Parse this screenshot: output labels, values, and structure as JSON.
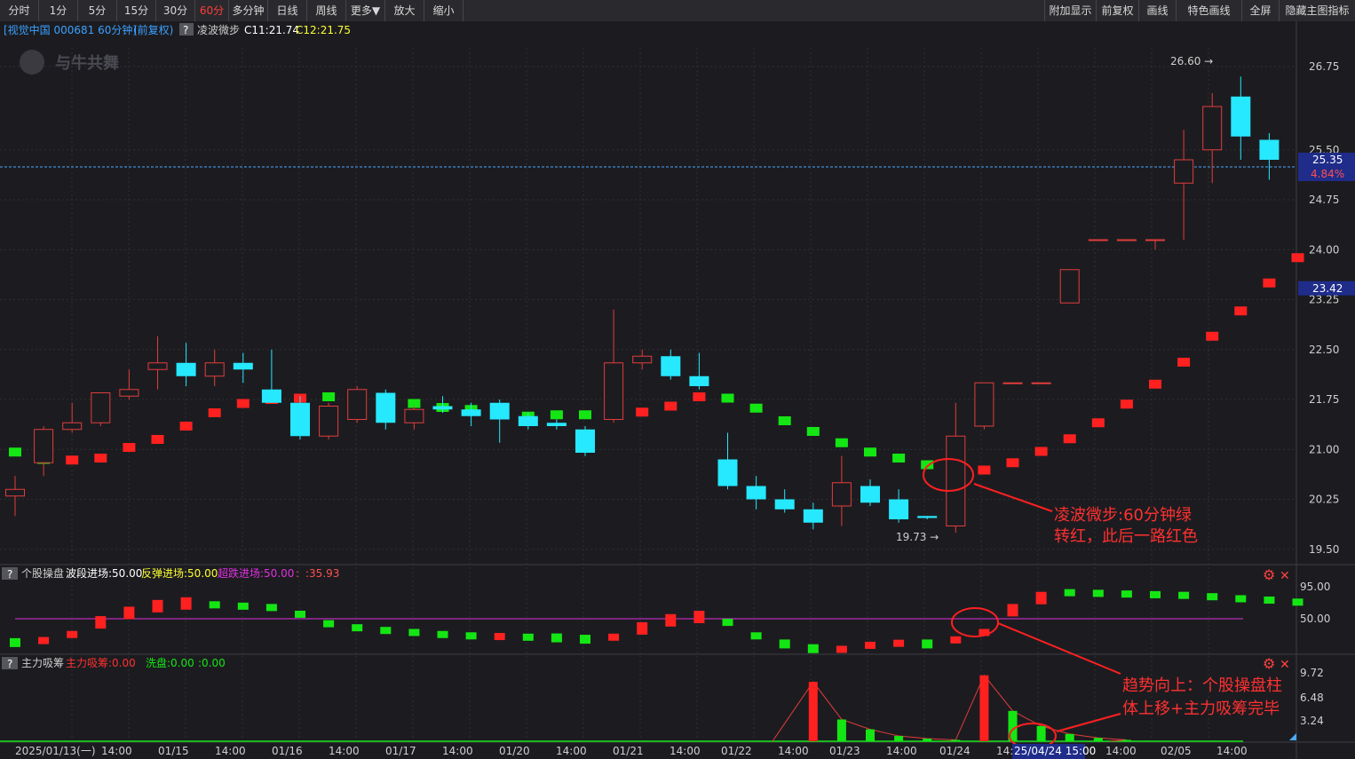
{
  "toolbar": {
    "left": [
      "分时",
      "1分",
      "5分",
      "15分",
      "30分",
      "60分",
      "多分钟",
      "日线",
      "周线",
      "更多▼",
      "放大",
      "缩小"
    ],
    "active": "60分",
    "right": [
      "附加显示",
      "前复权",
      "画线",
      "特色画线",
      "全屏",
      "隐藏主图指标"
    ]
  },
  "header": {
    "title": "[视觉中国 000681 60分钟]",
    "adjust": "(前复权)",
    "help": "?",
    "indicator": "凌波微步",
    "c1": "C11:21.74",
    "c2": "C12:21.75"
  },
  "watermark": "与牛共舞",
  "price_axis": {
    "ticks": [
      "26.75",
      "25.50",
      "24.75",
      "24.00",
      "23.25",
      "22.50",
      "21.75",
      "21.00",
      "20.25",
      "19.50"
    ],
    "current_price": "25.35",
    "current_pct": "4.84%",
    "level_price": "23.42"
  },
  "max_label": "26.60",
  "min_label": "19.73",
  "annotation1": {
    "line1": "凌波微步:60分钟绿",
    "line2": "转红，此后一路红色"
  },
  "annotation2": {
    "line1": "趋势向上：个股操盘柱",
    "line2": "体上移+主力吸筹完毕"
  },
  "panel2": {
    "help": "?",
    "name": "个股操盘",
    "s1": "波段进场:50.00",
    "s2": "反弹进场:50.00",
    "s3": "超跌进场:50.00",
    "s4": ":",
    "s5": ":35.93",
    "axis": [
      "95.00",
      "50.00"
    ]
  },
  "panel3": {
    "help": "?",
    "name": "主力吸筹",
    "s1": "主力吸筹:0.00",
    "s2": "洗盘:0.00",
    "s3": ":0.00",
    "axis": [
      "9.72",
      "6.48",
      "3.24"
    ]
  },
  "time_axis": [
    "2025/01/13(一)",
    "14:00",
    "01/15",
    "14:00",
    "01/16",
    "14:00",
    "01/17",
    "14:00",
    "01/20",
    "14:00",
    "01/21",
    "14:00",
    "01/22",
    "14:00",
    "01/23",
    "14:00",
    "01/24",
    "14:",
    "14:00",
    "02/05",
    "14:00"
  ],
  "crosshair_time": "25/04/24 15:00",
  "colors": {
    "up": "#ff2020",
    "down": "#26e8ff",
    "green": "#14e614",
    "magenta": "#e030e0",
    "bg": "#1c1c20"
  },
  "chart_data": {
    "type": "candlestick",
    "candles": [
      [
        20.3,
        20.4,
        20.6,
        20.0
      ],
      [
        20.8,
        21.3,
        21.35,
        20.6
      ],
      [
        21.3,
        21.4,
        21.7,
        21.25
      ],
      [
        21.4,
        21.85,
        21.85,
        21.35
      ],
      [
        21.8,
        21.9,
        22.2,
        21.75
      ],
      [
        22.2,
        22.3,
        22.7,
        21.9
      ],
      [
        22.3,
        22.1,
        22.6,
        21.95
      ],
      [
        22.1,
        22.3,
        22.5,
        21.95
      ],
      [
        22.3,
        22.2,
        22.45,
        22.0
      ],
      [
        21.9,
        21.7,
        22.5,
        21.7
      ],
      [
        21.7,
        21.2,
        21.8,
        21.15
      ],
      [
        21.2,
        21.65,
        21.7,
        21.15
      ],
      [
        21.45,
        21.9,
        21.95,
        21.4
      ],
      [
        21.85,
        21.4,
        21.9,
        21.3
      ],
      [
        21.4,
        21.6,
        21.65,
        21.3
      ],
      [
        21.65,
        21.6,
        21.8,
        21.55
      ],
      [
        21.6,
        21.5,
        21.7,
        21.35
      ],
      [
        21.7,
        21.45,
        21.75,
        21.1
      ],
      [
        21.5,
        21.35,
        21.55,
        21.3
      ],
      [
        21.4,
        21.35,
        21.45,
        21.3
      ],
      [
        21.3,
        20.95,
        21.35,
        20.9
      ],
      [
        21.45,
        22.3,
        23.1,
        21.4
      ],
      [
        22.3,
        22.4,
        22.5,
        22.2
      ],
      [
        22.4,
        22.1,
        22.5,
        22.05
      ],
      [
        22.1,
        21.95,
        22.45,
        21.9
      ],
      [
        20.85,
        20.45,
        21.25,
        20.4
      ],
      [
        20.45,
        20.25,
        20.6,
        20.1
      ],
      [
        20.25,
        20.1,
        20.4,
        20.05
      ],
      [
        20.1,
        19.9,
        20.2,
        19.8
      ],
      [
        20.15,
        20.5,
        20.9,
        19.85
      ],
      [
        20.45,
        20.2,
        20.55,
        20.15
      ],
      [
        20.25,
        19.95,
        20.4,
        19.9
      ],
      [
        20.0,
        19.97,
        20.0,
        19.95
      ],
      [
        19.85,
        21.2,
        21.7,
        19.75
      ],
      [
        21.35,
        22.0,
        22.0,
        21.3
      ],
      [
        22.0,
        22.0,
        22.0,
        22.0
      ],
      [
        22.0,
        22.0,
        22.0,
        22.0
      ],
      [
        23.2,
        23.7,
        23.7,
        23.25
      ],
      [
        24.15,
        24.15,
        24.15,
        24.15
      ],
      [
        24.15,
        24.15,
        24.15,
        24.15
      ],
      [
        24.15,
        24.15,
        24.15,
        24.0
      ],
      [
        25.0,
        25.35,
        25.8,
        24.15
      ],
      [
        25.5,
        26.15,
        26.35,
        25.0
      ],
      [
        26.3,
        25.7,
        26.6,
        25.35
      ],
      [
        25.65,
        25.35,
        25.75,
        25.05
      ]
    ],
    "signal_blocks": [
      [
        0,
        "green",
        20.96
      ],
      [
        1,
        "green",
        20.85
      ],
      [
        2,
        "red",
        20.84
      ],
      [
        3,
        "red",
        20.87
      ],
      [
        4,
        "red",
        21.03
      ],
      [
        5,
        "red",
        21.15
      ],
      [
        6,
        "red",
        21.35
      ],
      [
        7,
        "red",
        21.55
      ],
      [
        8,
        "red",
        21.69
      ],
      [
        9,
        "red",
        21.75
      ],
      [
        10,
        "red",
        21.77
      ],
      [
        11,
        "green",
        21.79
      ],
      [
        12,
        "green",
        21.76
      ],
      [
        13,
        "green",
        21.71
      ],
      [
        14,
        "green",
        21.69
      ],
      [
        15,
        "green",
        21.63
      ],
      [
        16,
        "green",
        21.6
      ],
      [
        17,
        "green",
        21.58
      ],
      [
        18,
        "green",
        21.5
      ],
      [
        19,
        "green",
        21.52
      ],
      [
        20,
        "green",
        21.52
      ],
      [
        21,
        "red",
        21.53
      ],
      [
        22,
        "red",
        21.56
      ],
      [
        23,
        "red",
        21.65
      ],
      [
        24,
        "red",
        21.79
      ],
      [
        25,
        "green",
        21.77
      ],
      [
        26,
        "green",
        21.62
      ],
      [
        27,
        "green",
        21.43
      ],
      [
        28,
        "green",
        21.27
      ],
      [
        29,
        "green",
        21.1
      ],
      [
        30,
        "green",
        20.96
      ],
      [
        31,
        "green",
        20.87
      ],
      [
        32,
        "green",
        20.77
      ],
      [
        33,
        "green",
        20.68
      ],
      [
        34,
        "red",
        20.69
      ],
      [
        35,
        "red",
        20.8
      ],
      [
        36,
        "red",
        20.97
      ],
      [
        37,
        "red",
        21.16
      ],
      [
        38,
        "red",
        21.4
      ],
      [
        39,
        "red",
        21.68
      ],
      [
        40,
        "red",
        21.98
      ],
      [
        41,
        "red",
        22.31
      ],
      [
        42,
        "red",
        22.7
      ],
      [
        43,
        "red",
        23.08
      ],
      [
        44,
        "red",
        23.5
      ],
      [
        45,
        "red",
        23.88
      ]
    ],
    "panel2_blocks": [
      [
        0,
        "green",
        12
      ],
      [
        1,
        "red",
        15
      ],
      [
        2,
        "red",
        24
      ],
      [
        3,
        "red",
        42
      ],
      [
        4,
        "red",
        56
      ],
      [
        5,
        "red",
        66
      ],
      [
        6,
        "red",
        70
      ],
      [
        7,
        "green",
        68
      ],
      [
        8,
        "green",
        66
      ],
      [
        9,
        "green",
        64
      ],
      [
        10,
        "green",
        54
      ],
      [
        11,
        "green",
        40
      ],
      [
        12,
        "green",
        34
      ],
      [
        13,
        "green",
        30
      ],
      [
        14,
        "green",
        27
      ],
      [
        15,
        "green",
        24
      ],
      [
        16,
        "green",
        22
      ],
      [
        17,
        "red",
        21
      ],
      [
        18,
        "green",
        20
      ],
      [
        19,
        "green",
        19
      ],
      [
        20,
        "green",
        17
      ],
      [
        21,
        "red",
        20
      ],
      [
        22,
        "red",
        33
      ],
      [
        23,
        "red",
        45
      ],
      [
        24,
        "red",
        50
      ],
      [
        25,
        "green",
        42
      ],
      [
        26,
        "green",
        22
      ],
      [
        27,
        "green",
        10
      ],
      [
        28,
        "green",
        3
      ],
      [
        29,
        "red",
        2
      ],
      [
        30,
        "red",
        8
      ],
      [
        31,
        "red",
        11
      ],
      [
        32,
        "green",
        10
      ],
      [
        33,
        "red",
        16
      ],
      [
        34,
        "red",
        27
      ],
      [
        35,
        "red",
        60
      ],
      [
        36,
        "red",
        78
      ],
      [
        37,
        "green",
        86
      ],
      [
        38,
        "green",
        85
      ],
      [
        39,
        "green",
        84
      ],
      [
        40,
        "green",
        83
      ],
      [
        41,
        "green",
        82
      ],
      [
        42,
        "green",
        80
      ],
      [
        43,
        "green",
        77
      ],
      [
        44,
        "green",
        75
      ],
      [
        45,
        "green",
        72
      ]
    ],
    "panel3_bars": [
      [
        28,
        "red",
        9.0
      ],
      [
        29,
        "green",
        3.3
      ],
      [
        30,
        "green",
        1.8
      ],
      [
        31,
        "green",
        0.8
      ],
      [
        32,
        "green",
        0.4
      ],
      [
        33,
        "green",
        0.2
      ],
      [
        34,
        "red",
        10.0
      ],
      [
        35,
        "green",
        4.6
      ],
      [
        36,
        "green",
        2.3
      ],
      [
        37,
        "green",
        1.1
      ],
      [
        38,
        "green",
        0.5
      ],
      [
        39,
        "green",
        0.2
      ]
    ],
    "y_range": [
      19.35,
      26.95
    ],
    "panel2_range": [
      0,
      100
    ],
    "panel3_range": [
      0,
      10.5
    ]
  }
}
